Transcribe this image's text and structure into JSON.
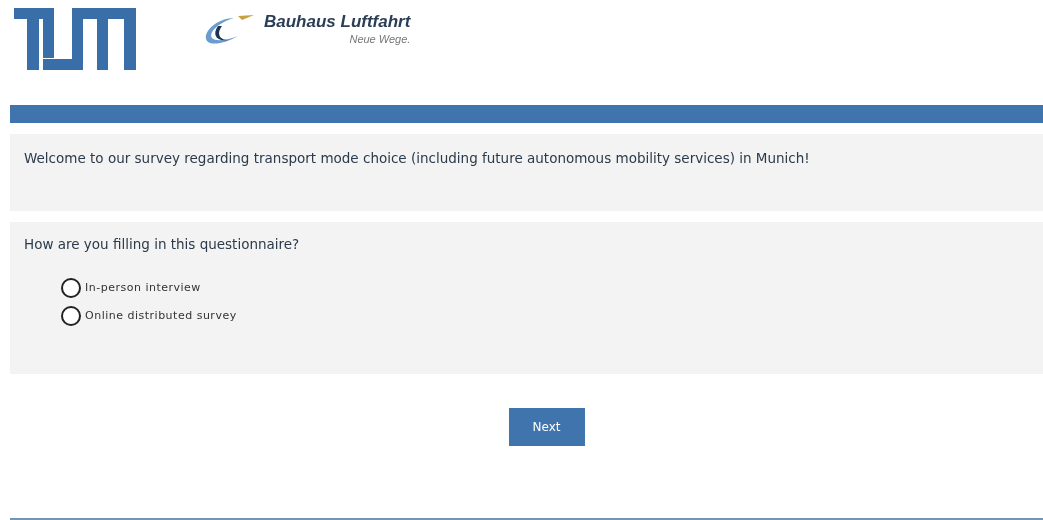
{
  "header": {
    "partner_logo": {
      "name": "Bauhaus Luftfahrt",
      "tagline": "Neue Wege."
    }
  },
  "welcome": "Welcome to our survey regarding transport mode choice (including future autonomous mobility services) in Munich!",
  "question": {
    "text": "How are you filling in this questionnaire?",
    "options": [
      {
        "label": "In-person interview",
        "selected": false
      },
      {
        "label": "Online distributed survey",
        "selected": false
      }
    ]
  },
  "next_button": "Next"
}
